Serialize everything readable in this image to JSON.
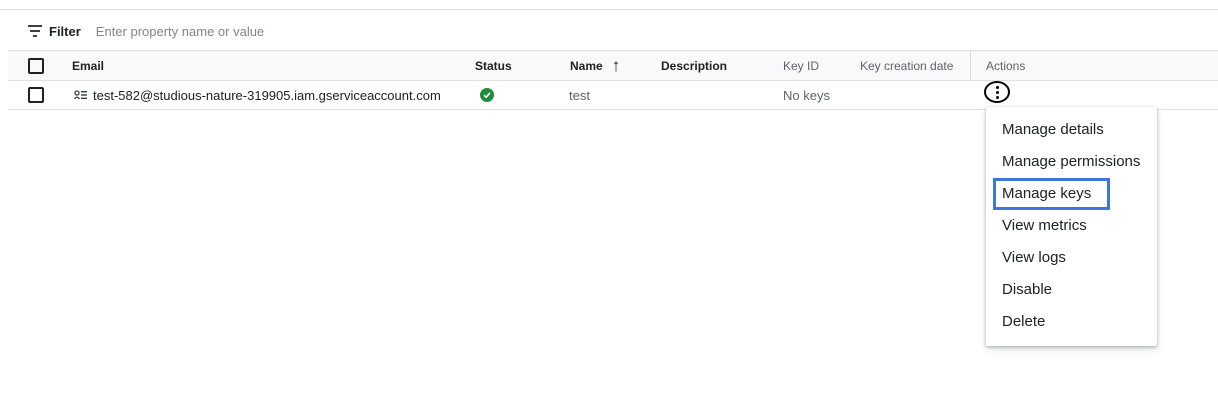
{
  "filter": {
    "label": "Filter",
    "placeholder": "Enter property name or value"
  },
  "table": {
    "columns": {
      "email": "Email",
      "status": "Status",
      "name": "Name",
      "description": "Description",
      "key_id": "Key ID",
      "key_creation_date": "Key creation date",
      "actions": "Actions"
    },
    "sort": {
      "column": "name",
      "direction": "ascending",
      "arrow": "↑"
    },
    "rows": [
      {
        "email": "test-582@studious-nature-319905.iam.gserviceaccount.com",
        "status": "enabled",
        "name": "test",
        "description": "",
        "key_id": "No keys",
        "key_creation_date": ""
      }
    ]
  },
  "actions_menu": {
    "items": [
      "Manage details",
      "Manage permissions",
      "Manage keys",
      "View metrics",
      "View logs",
      "Disable",
      "Delete"
    ],
    "highlighted": "Manage keys"
  },
  "colors": {
    "status_ok": "#1e8e3e",
    "highlight_outline": "#3c78d8",
    "header_bg": "#f8f9fa"
  }
}
